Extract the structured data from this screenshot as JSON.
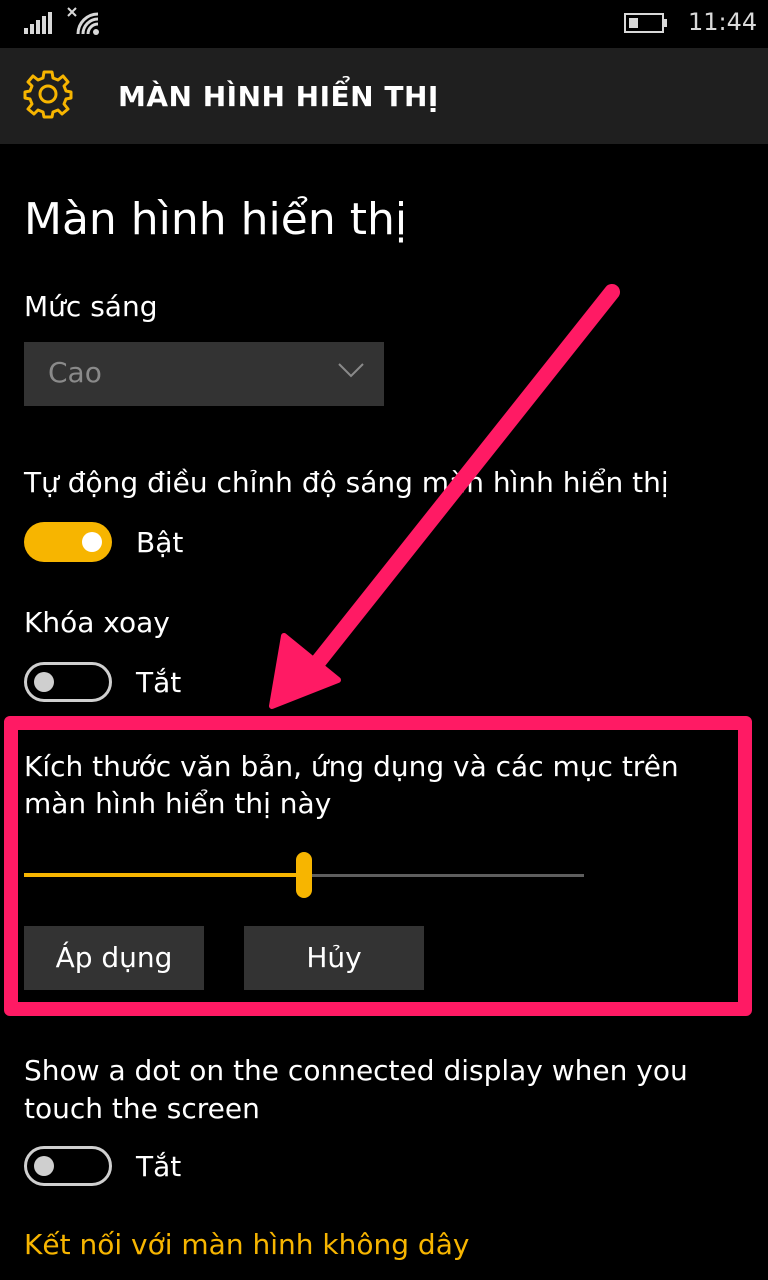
{
  "status_bar": {
    "time": "11:44"
  },
  "header": {
    "title": "MÀN HÌNH HIỂN THỊ"
  },
  "page": {
    "title": "Màn hình hiển thị"
  },
  "brightness": {
    "label": "Mức sáng",
    "value": "Cao"
  },
  "auto_brightness": {
    "label": "Tự động điều chỉnh độ sáng màn hình hiển thị",
    "state_text": "Bật",
    "on": true
  },
  "rotation_lock": {
    "label": "Khóa xoay",
    "state_text": "Tắt",
    "on": false
  },
  "scale": {
    "label": "Kích thước văn bản, ứng dụng và các mục trên màn hình hiển thị này",
    "slider_fraction": 0.5,
    "apply_label": "Áp dụng",
    "cancel_label": "Hủy"
  },
  "touch_dot": {
    "label": "Show a dot on the connected display when you touch the screen",
    "state_text": "Tắt",
    "on": false
  },
  "wireless_link": "Kết nối với màn hình không dây",
  "colors": {
    "accent": "#f7b500",
    "annotation": "#ff1a64",
    "background": "#000000",
    "header_bg": "#1f1f1f"
  }
}
